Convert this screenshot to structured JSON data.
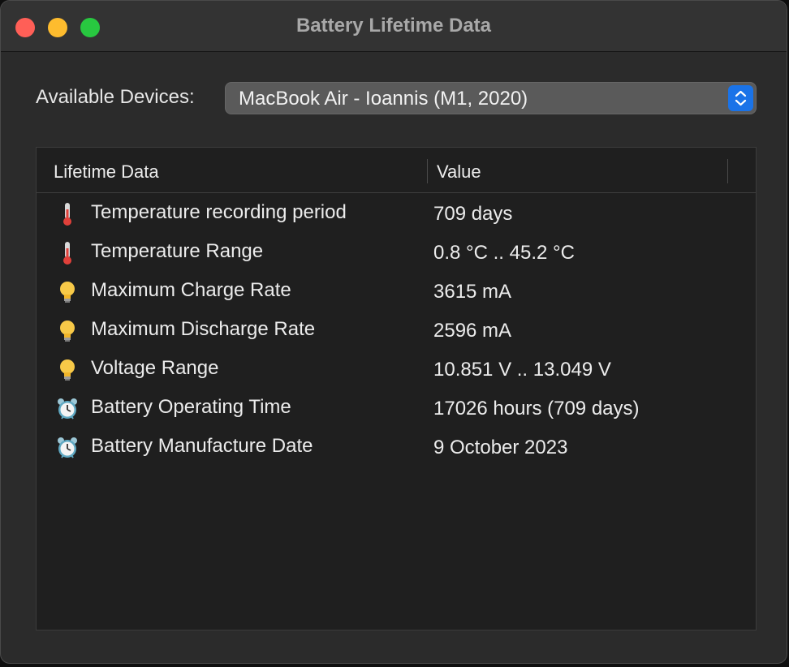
{
  "window": {
    "title": "Battery Lifetime Data"
  },
  "devices": {
    "label": "Available Devices:",
    "selected": "MacBook Air - Ioannis (M1, 2020)"
  },
  "table": {
    "columns": [
      "Lifetime Data",
      "Value"
    ],
    "rows": [
      {
        "icon": "thermometer-icon",
        "label": "Temperature recording period",
        "value": "709 days"
      },
      {
        "icon": "thermometer-icon",
        "label": "Temperature Range",
        "value": "0.8 °C .. 45.2 °C"
      },
      {
        "icon": "light-bulb-icon",
        "label": "Maximum Charge Rate",
        "value": "3615 mA"
      },
      {
        "icon": "light-bulb-icon",
        "label": "Maximum Discharge Rate",
        "value": "2596 mA"
      },
      {
        "icon": "light-bulb-icon",
        "label": "Voltage Range",
        "value": "10.851 V .. 13.049 V"
      },
      {
        "icon": "alarm-clock-icon",
        "label": "Battery Operating Time",
        "value": "17026 hours (709 days)"
      },
      {
        "icon": "alarm-clock-icon",
        "label": "Battery Manufacture Date",
        "value": "9 October 2023"
      }
    ]
  },
  "colors": {
    "close": "#ff5f57",
    "minimize": "#febc2e",
    "maximize": "#28c840",
    "accent": "#1a73e8"
  }
}
